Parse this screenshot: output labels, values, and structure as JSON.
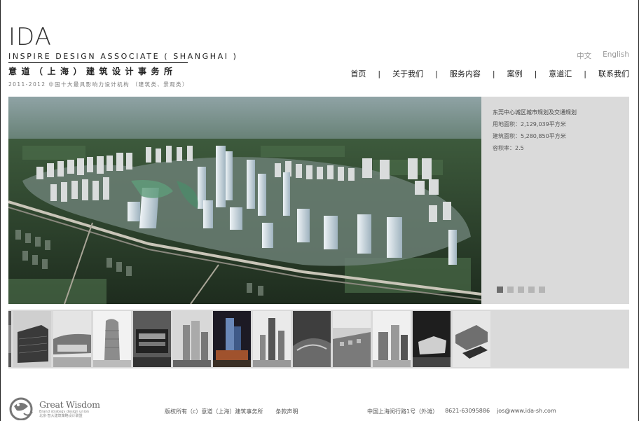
{
  "brand": {
    "mark": "IDA",
    "english_name": "INSPIRE   DESIGN   ASSOCIATE ( SHANGHAI )",
    "chinese_name": "意道（上海）建筑设计事务所",
    "tagline": "2011-2012  中国十大最具影响力设计机构 （建筑类、景观类）"
  },
  "language": {
    "chinese": "中文",
    "english": "English"
  },
  "nav": {
    "items": [
      "首页",
      "关于我们",
      "服务内容",
      "案例",
      "意道汇",
      "联系我们"
    ],
    "separator": "|"
  },
  "hero": {
    "project_title": "东莞中心城区城市规划及交通规划",
    "land_area": "用地面积：2,129,039平方米",
    "building_area": "建筑面积：5,280,850平方米",
    "plot_ratio": "容积率：2.5",
    "slide_count": 5,
    "active_slide": 1
  },
  "thumbnails": {
    "count": 13
  },
  "footer": {
    "logo_name": "Great Wisdom",
    "logo_sub_1": "Brand strategy design union",
    "logo_sub_2": "北京·智大建筑策略设计联盟",
    "copyright": "版权所有（c）意道（上海）建筑事务所",
    "terms": "条款声明",
    "address": "中国上海闵行路1号（外滩）",
    "phone": "8621-63095886",
    "email": "jos@www.ida-sh.com"
  },
  "colors": {
    "panel_bg": "#dadada",
    "text_dark": "#222222",
    "text_muted": "#999999",
    "dot_active": "#6d6d6d",
    "dot_inactive": "#b5b5b5"
  }
}
